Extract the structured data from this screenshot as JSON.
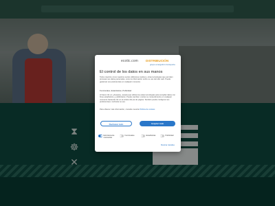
{
  "background": {
    "side_icons": [
      "hourglass-icon",
      "handshake-icon",
      "tools-icon"
    ]
  },
  "consent": {
    "logo": {
      "main": "ecotic.com",
      "brand": "DISTRIBUCIÓN",
      "tagline": "grupo energético transporte"
    },
    "title": "El control de los datos en sus manos",
    "text1": "Tanto nosotros como nuestros socios utilizamos cookies y otras tecnologías que permiten procesar sus datos personales, como la información sobre su uso del sitio web. Puede gestionar sus preferencias en cualquier momento.",
    "purposes": "Funcionales, Estadísticas, Publicidad",
    "text2": "Al hacer clic en «Aceptar», acepta que utilicemos estas tecnologías para recopilar datos con fines estadísticos y publicitarios. Puede cambiar o retirar su consentimiento en cualquier momento haciendo clic en el enlace del pie de página. También puede configurar sus preferencias o rechazar su uso.",
    "text3": "Para obtener más información, consulte nuestra",
    "policy_link": "Política de cookies",
    "reject_label": "Rechazar todo",
    "accept_label": "Aceptar todo",
    "toggles": [
      {
        "label": "Estrictamente necesarias",
        "on": true
      },
      {
        "label": "Funcionales",
        "on": false
      },
      {
        "label": "Estadísticas",
        "on": false
      },
      {
        "label": "Publicidad",
        "on": false
      }
    ],
    "details_label": "Mostrar detalles"
  }
}
